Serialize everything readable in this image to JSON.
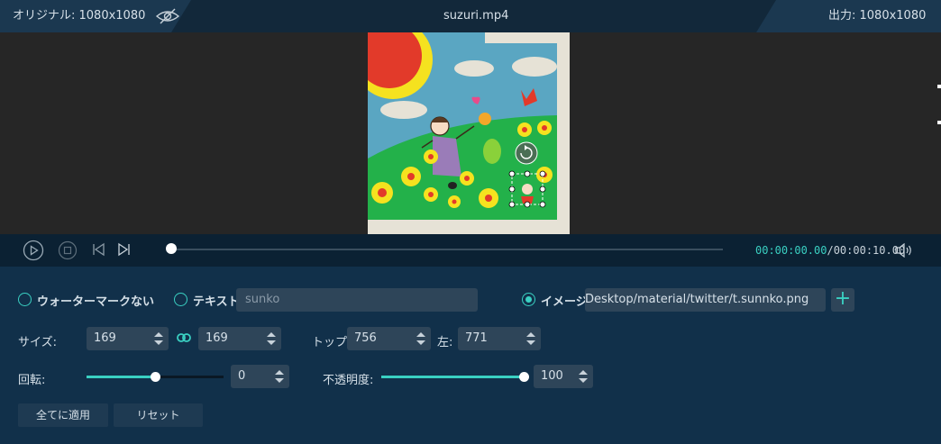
{
  "header": {
    "original_label": "オリジナル: 1080x1080",
    "file_name": "suzuri.mp4",
    "output_label": "出力: 1080x1080"
  },
  "playback": {
    "current_time": "00:00:00.00",
    "total_time": "/00:00:10.00",
    "progress": 0.0
  },
  "watermark": {
    "none_label": "ウォーターマークない",
    "text_label": "テキスト",
    "text_value": "sunko",
    "image_label": "イメージ",
    "image_path": "Desktop/material/twitter/t.sunnko.png",
    "add_label": "+",
    "selected": "image"
  },
  "size": {
    "label": "サイズ:",
    "width": "169",
    "height": "169"
  },
  "position": {
    "top_label": "トップ:",
    "top_value": "756",
    "left_label": "左:",
    "left_value": "771"
  },
  "rotation": {
    "label": "回転:",
    "value": "0",
    "slider_fraction": 0.5
  },
  "opacity": {
    "label": "不透明度:",
    "value": "100",
    "slider_fraction": 1.0
  },
  "buttons": {
    "apply_all": "全てに適用",
    "reset": "リセット"
  },
  "colors": {
    "accent": "#3ad0c2",
    "panel": "#11304a",
    "field": "#2e4559"
  }
}
